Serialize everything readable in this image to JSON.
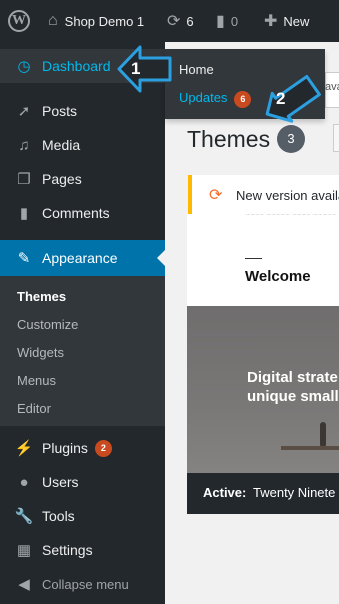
{
  "adminbar": {
    "wp_logo_icon": "wordpress-logo-icon",
    "site_name": "Shop Demo 1",
    "updates_count": "6",
    "comments_count": "0",
    "new_label": "New"
  },
  "sidebar": {
    "dashboard": "Dashboard",
    "posts": "Posts",
    "media": "Media",
    "pages": "Pages",
    "comments": "Comments",
    "appearance": "Appearance",
    "submenu": [
      "Themes",
      "Customize",
      "Widgets",
      "Menus",
      "Editor"
    ],
    "plugins": "Plugins",
    "plugins_badge": "2",
    "users": "Users",
    "tools": "Tools",
    "settings": "Settings",
    "collapse": "Collapse menu"
  },
  "flyout": {
    "home": "Home",
    "updates": "Updates",
    "updates_badge": "6"
  },
  "main": {
    "search_partial": "ava",
    "page_title": "Themes",
    "theme_count": "3",
    "notice": "New version availa",
    "theme_preview": {
      "welcome": "Welcome",
      "headline_line1": "Digital strate",
      "headline_line2": "unique small"
    },
    "active_label": "Active:",
    "active_name": "Twenty Ninete"
  },
  "annotations": {
    "step1": "1",
    "step2": "2",
    "color": "#2b9fe0"
  },
  "colors": {
    "adminbar_bg": "#23282d",
    "accent": "#0073aa",
    "highlight": "#00b9eb",
    "badge": "#ca4a1f",
    "notice_border": "#ffb900"
  }
}
